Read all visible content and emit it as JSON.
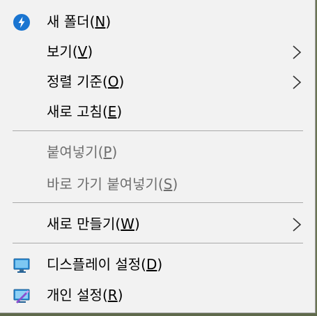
{
  "menu": {
    "items": [
      {
        "label": "새 폴더",
        "mnemonic": "N",
        "icon": "new-folder-badge-icon",
        "submenu": false,
        "disabled": false
      },
      {
        "label": "보기",
        "mnemonic": "V",
        "submenu": true,
        "disabled": false
      },
      {
        "label": "정렬 기준",
        "mnemonic": "O",
        "submenu": true,
        "disabled": false
      },
      {
        "label": "새로 고침",
        "mnemonic": "E",
        "submenu": false,
        "disabled": false
      },
      {
        "label": "붙여넣기",
        "mnemonic": "P",
        "submenu": false,
        "disabled": true
      },
      {
        "label": "바로 가기 붙여넣기",
        "mnemonic": "S",
        "submenu": false,
        "disabled": true
      },
      {
        "label": "새로 만들기",
        "mnemonic": "W",
        "submenu": true,
        "disabled": false
      },
      {
        "label": "디스플레이 설정",
        "mnemonic": "D",
        "icon": "display-settings-icon",
        "submenu": false,
        "disabled": false
      },
      {
        "label": "개인 설정",
        "mnemonic": "R",
        "icon": "personalize-icon",
        "submenu": false,
        "disabled": false
      }
    ]
  },
  "colors": {
    "menu_background": "#f2f2f2",
    "disabled_text": "#6d6d6d",
    "separator": "#a9a9a9",
    "accent_blue": "#1a75d1"
  }
}
